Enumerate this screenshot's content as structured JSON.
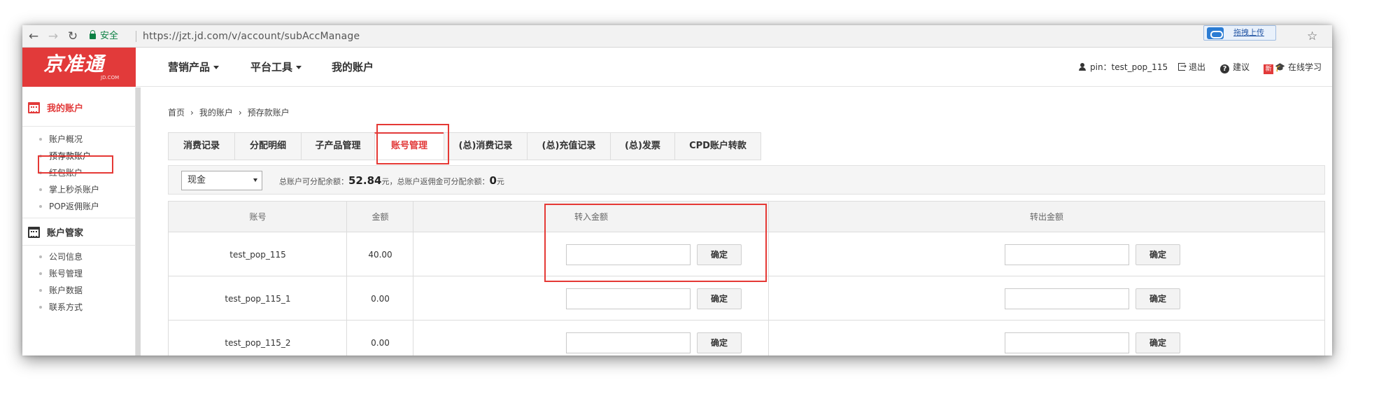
{
  "browser": {
    "secure_label": "安全",
    "url": "https://jzt.jd.com/v/account/subAccManage",
    "extension_label": "拖拽上传"
  },
  "header": {
    "logo_text": "京准通",
    "logo_sub": "JD.COM",
    "nav": [
      {
        "label": "营销产品",
        "dropdown": true
      },
      {
        "label": "平台工具",
        "dropdown": true
      },
      {
        "label": "我的账户",
        "dropdown": false
      }
    ],
    "user_label": "pin：test_pop_115",
    "logout_label": "退出",
    "suggest_label": "建议",
    "new_badge": "新",
    "learn_label": "在线学习"
  },
  "sidebar": {
    "sections": [
      {
        "title": "我的账户",
        "active": true,
        "items": [
          "账户概况",
          "预存款账户",
          "红包账户",
          "掌上秒杀账户",
          "POP返佣账户"
        ]
      },
      {
        "title": "账户管家",
        "active": false,
        "items": [
          "公司信息",
          "账号管理",
          "账户数据",
          "联系方式"
        ]
      }
    ],
    "active_item": "预存款账户"
  },
  "breadcrumb": [
    "首页",
    "我的账户",
    "预存款账户"
  ],
  "tabs": [
    {
      "label": "消费记录",
      "active": false
    },
    {
      "label": "分配明细",
      "active": false
    },
    {
      "label": "子产品管理",
      "active": false
    },
    {
      "label": "账号管理",
      "active": true
    },
    {
      "label": "(总)消费记录",
      "active": false
    },
    {
      "label": "(总)充值记录",
      "active": false
    },
    {
      "label": "(总)发票",
      "active": false
    },
    {
      "label": "CPD账户转款",
      "active": false
    }
  ],
  "filter": {
    "select_value": "现金",
    "balance_prefix": "总账户可分配余额：",
    "balance_value": "52.84",
    "balance_unit": "元，总账户返佣金可分配余额：",
    "rebate_value": "0",
    "rebate_unit": "元"
  },
  "table": {
    "headers": [
      "账号",
      "金额",
      "转入金额",
      "转出金额"
    ],
    "confirm_label": "确定",
    "rows": [
      {
        "account": "test_pop_115",
        "amount": "40.00"
      },
      {
        "account": "test_pop_115_1",
        "amount": "0.00"
      },
      {
        "account": "test_pop_115_2",
        "amount": "0.00"
      }
    ]
  },
  "colors": {
    "brand_red": "#e23a3a",
    "annotation_red": "#e53935"
  }
}
